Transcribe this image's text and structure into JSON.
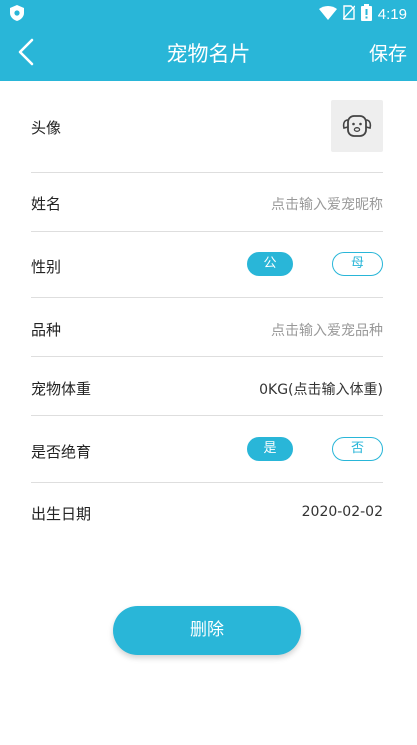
{
  "status_bar": {
    "time": "4:19",
    "icons": [
      "shield-icon",
      "wifi-icon",
      "no-sim-icon",
      "battery-icon"
    ]
  },
  "app_bar": {
    "title": "宠物名片",
    "save_label": "保存",
    "back_icon": "chevron-left-icon"
  },
  "form": {
    "avatar": {
      "label": "头像",
      "icon": "pet-avatar-placeholder-icon"
    },
    "name": {
      "label": "姓名",
      "placeholder": "点击输入爱宠昵称"
    },
    "gender": {
      "label": "性别",
      "options": [
        "公",
        "母"
      ],
      "selected": "公"
    },
    "breed": {
      "label": "品种",
      "placeholder": "点击输入爱宠品种"
    },
    "weight": {
      "label": "宠物体重",
      "value": "0KG(点击输入体重)"
    },
    "neutered": {
      "label": "是否绝育",
      "options": [
        "是",
        "否"
      ],
      "selected": "是"
    },
    "birthdate": {
      "label": "出生日期",
      "value": "2020-02-02"
    }
  },
  "delete_label": "删除",
  "colors": {
    "accent": "#29b6d8",
    "divider": "#dedede",
    "placeholder": "#999999"
  }
}
